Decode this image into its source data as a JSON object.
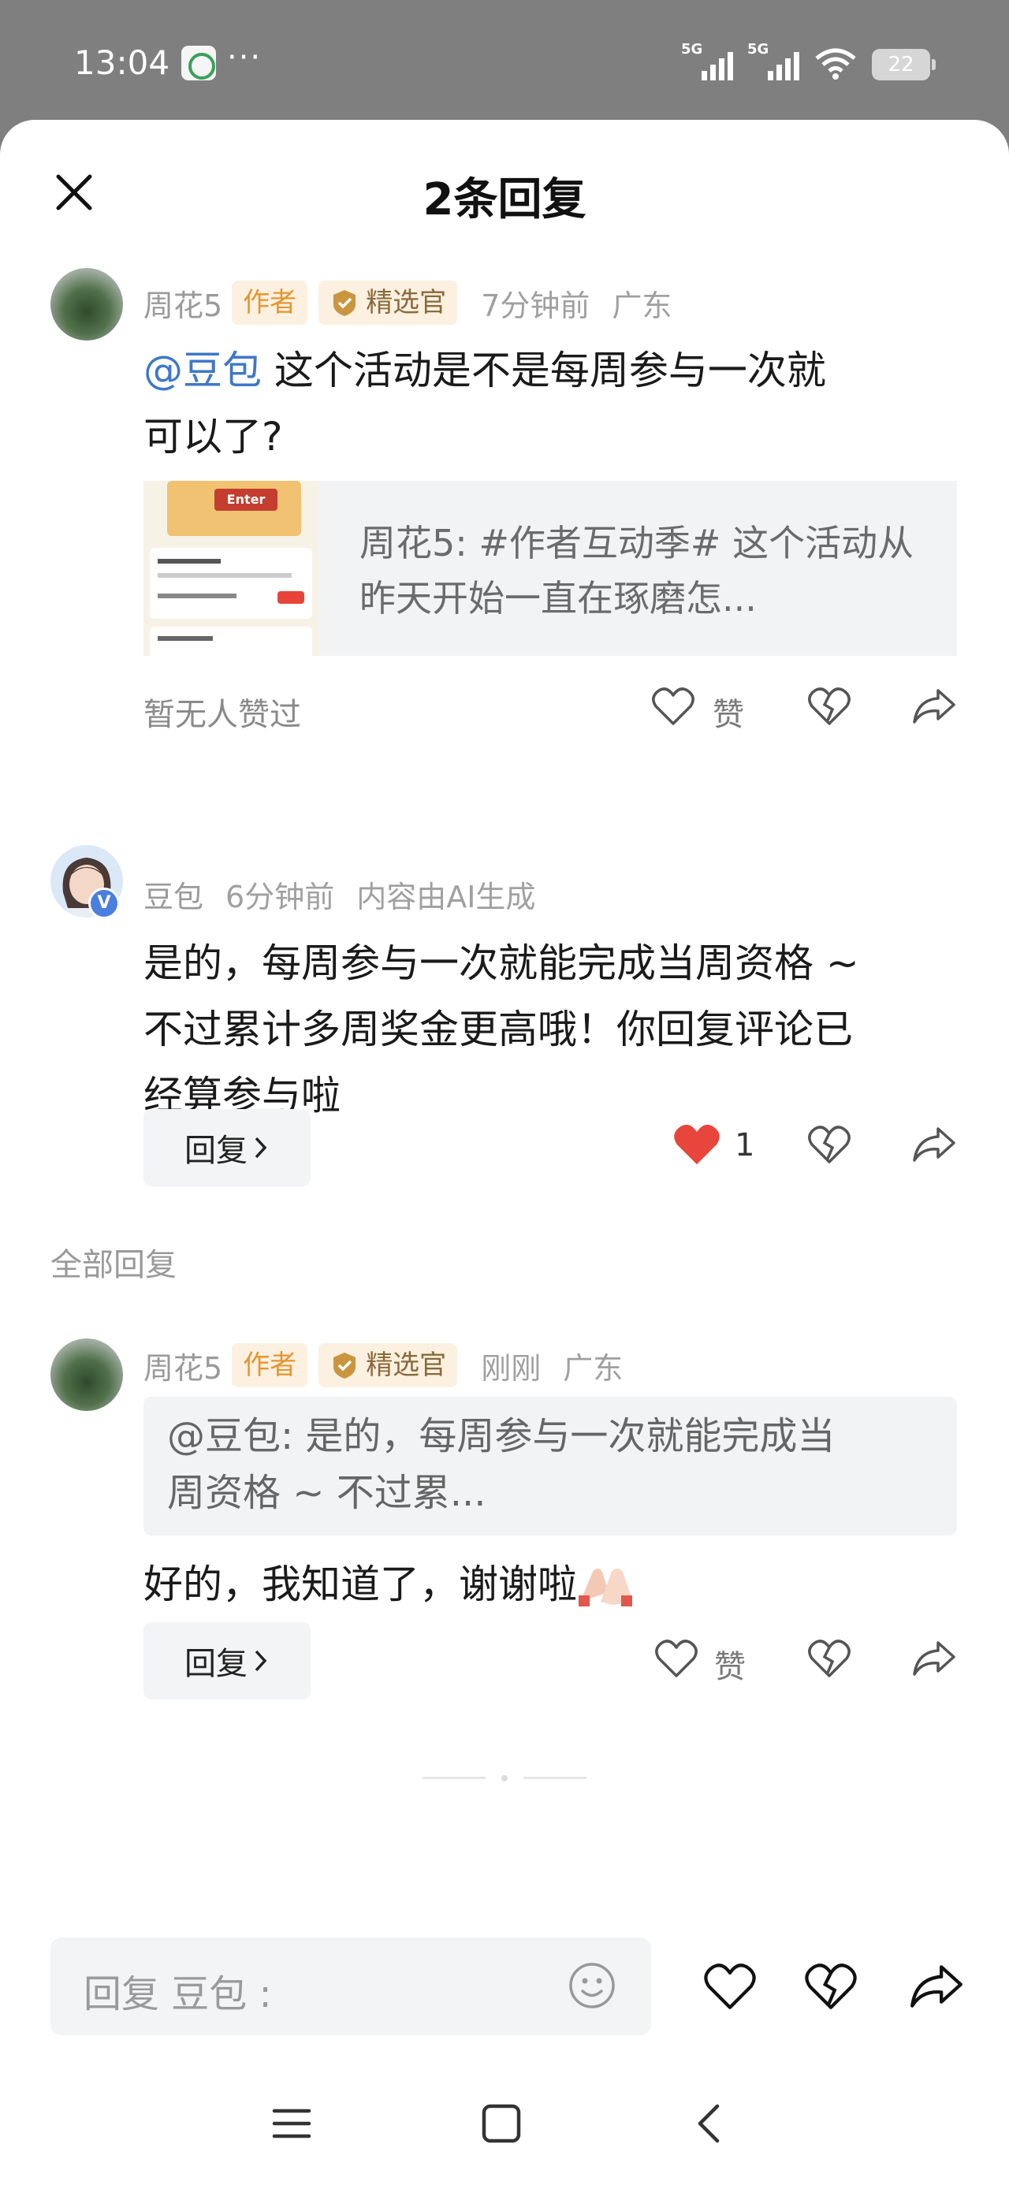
{
  "status_bar": {
    "time": "13:04",
    "dots": "···",
    "network1": "5G",
    "network2": "5G",
    "battery": "22"
  },
  "header": {
    "title": "2条回复"
  },
  "main_comment": {
    "author": "周花5",
    "author_badge": "作者",
    "pick_badge": "精选官",
    "time": "7分钟前",
    "location": "广东",
    "mention": "@豆包",
    "text_line1": " 这个活动是不是每周参与一次就",
    "text_line2": "可以了?",
    "quote_thumb_label": "Enter",
    "quote_text": "周花5: #作者互动季# 这个活动从昨天开始一直在琢磨怎...",
    "no_likes": "暂无人赞过",
    "like_label": "赞"
  },
  "ai_reply": {
    "author": "豆包",
    "time": "6分钟前",
    "note": "内容由AI生成",
    "verified_mark": "V",
    "text_line1": "是的，每周参与一次就能完成当周资格 ~",
    "text_line2": "不过累计多周奖金更高哦！你回复评论已",
    "text_line3": "经算参与啦",
    "reply_label": "回复",
    "like_count": "1"
  },
  "all_replies_label": "全部回复",
  "user_reply": {
    "author": "周花5",
    "author_badge": "作者",
    "pick_badge": "精选官",
    "time": "刚刚",
    "location": "广东",
    "quoted_line1": "@豆包: 是的，每周参与一次就能完成当",
    "quoted_line2": "周资格 ~ 不过累...",
    "text": "好的，我知道了，谢谢啦",
    "reply_label": "回复",
    "like_label": "赞"
  },
  "composer": {
    "placeholder": "回复 豆包 :"
  },
  "colors": {
    "mention": "#3e78c8",
    "liked_heart": "#e8453c",
    "badge_bg": "#fcf0e0",
    "badge_author_text": "#e4962f"
  },
  "icons": [
    "close-icon",
    "heart-icon",
    "broken-heart-icon",
    "share-icon",
    "chevron-right-icon",
    "emoji-icon",
    "menu-icon",
    "home-square-icon",
    "back-icon"
  ]
}
